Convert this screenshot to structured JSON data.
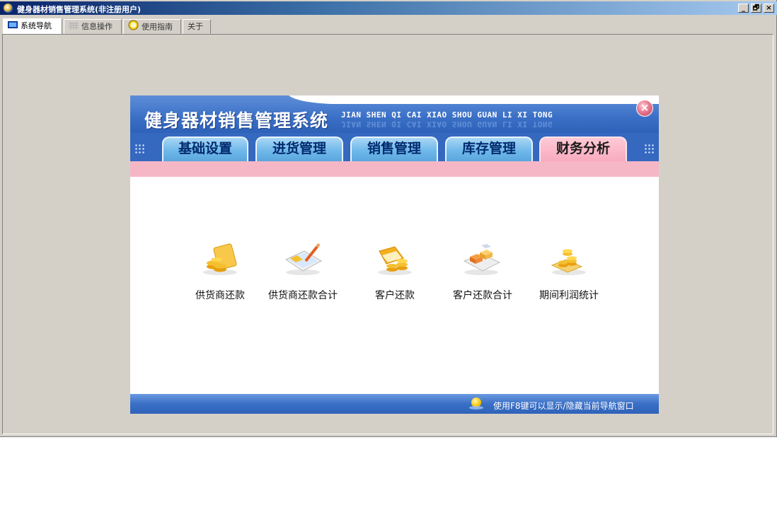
{
  "window": {
    "title": "健身器材销售管理系统(非注册用户)",
    "min_label": "_",
    "restore_label": "🗗",
    "close_label": "×"
  },
  "tabs": [
    {
      "label": "系统导航",
      "icon": "monitor-icon",
      "active": true
    },
    {
      "label": "信息操作",
      "icon": "grid-icon",
      "active": false
    },
    {
      "label": "使用指南",
      "icon": "clock-icon",
      "active": false
    },
    {
      "label": "关于",
      "icon": "",
      "active": false
    }
  ],
  "panel": {
    "title": "健身器材销售管理系统",
    "pinyin": "JIAN SHEN QI CAI XIAO SHOU GUAN LI XI TONG",
    "close_label": "×",
    "nav": [
      {
        "label": "基础设置",
        "active": false
      },
      {
        "label": "进货管理",
        "active": false
      },
      {
        "label": "销售管理",
        "active": false
      },
      {
        "label": "库存管理",
        "active": false
      },
      {
        "label": "财务分析",
        "active": true
      }
    ],
    "items": [
      {
        "label": "供货商还款",
        "icon": "card-coins-icon"
      },
      {
        "label": "供货商还款合计",
        "icon": "document-pen-icon"
      },
      {
        "label": "客户还款",
        "icon": "coins-stack-icon"
      },
      {
        "label": "客户还款合计",
        "icon": "boxes-icon"
      },
      {
        "label": "期间利润统计",
        "icon": "coins-pile-icon"
      }
    ],
    "tip": "使用F8键可以显示/隐藏当前导航窗口"
  },
  "colors": {
    "header_blue": "#3568bf",
    "pink_active": "#f7a8bd",
    "tab_blue": "#6fb8ea",
    "window_gray": "#d4d0c8"
  }
}
